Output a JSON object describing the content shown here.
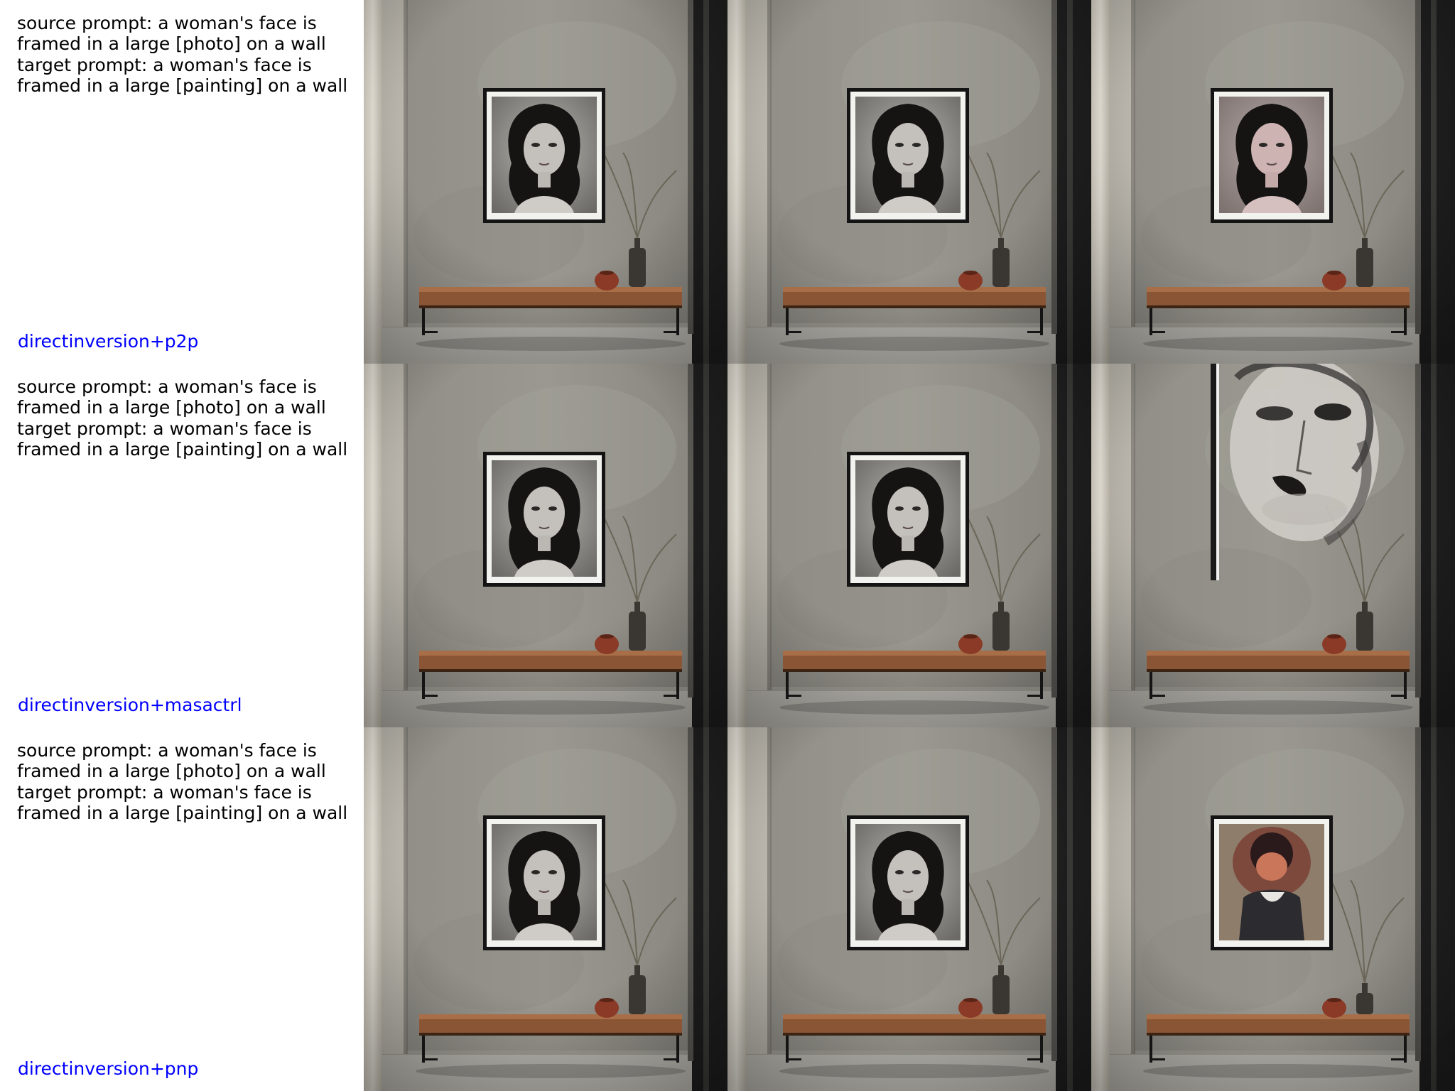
{
  "colors": {
    "method_label": "#0000ff",
    "prompt_text": "#000000",
    "wall": "#9a9890",
    "floor": "#b9b7b0",
    "bench_wood": "#8a5535",
    "frame": "#141414",
    "mat": "#f2f2ef"
  },
  "rows": [
    {
      "prompt_lines": [
        "source prompt: a woman's face is",
        "framed in a large [photo] on a wall",
        "target prompt: a woman's face is",
        "framed in a large [painting] on a wall"
      ],
      "method": "directinversion+p2p",
      "panel_variants": [
        "source",
        "reconstruction",
        "edit-tinted-photo"
      ]
    },
    {
      "prompt_lines": [
        "source prompt: a woman's face is",
        "framed in a large [photo] on a wall",
        "target prompt: a woman's face is",
        "framed in a large [painting] on a wall"
      ],
      "method": "directinversion+masactrl",
      "panel_variants": [
        "source",
        "reconstruction",
        "edit-large-face-painting"
      ]
    },
    {
      "prompt_lines": [
        "source prompt: a woman's face is",
        "framed in a large [photo] on a wall",
        "target prompt: a woman's face is",
        "framed in a large [painting] on a wall"
      ],
      "method": "directinversion+pnp",
      "panel_variants": [
        "source",
        "reconstruction",
        "edit-colored-portrait"
      ]
    }
  ]
}
